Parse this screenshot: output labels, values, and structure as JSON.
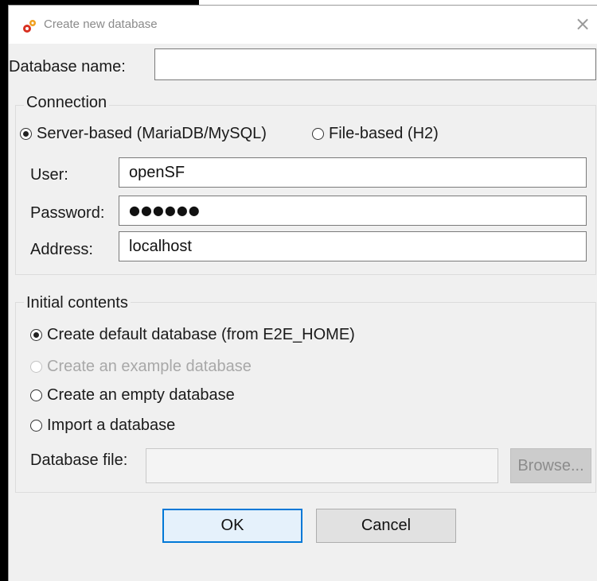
{
  "window": {
    "title": "Create new database",
    "app_icon": "gear-cluster-icon",
    "close_icon": "close-icon",
    "close_glyph": "×"
  },
  "database_name": {
    "label": "Database name:",
    "value": ""
  },
  "connection": {
    "title": "Connection",
    "modes": [
      {
        "label": "Server-based (MariaDB/MySQL)",
        "selected": true
      },
      {
        "label": "File-based (H2)",
        "selected": false
      }
    ],
    "user": {
      "label": "User:",
      "value": "openSF"
    },
    "password": {
      "label": "Password:",
      "masked_value": "●●●●●●"
    },
    "address": {
      "label": "Address:",
      "value": "localhost"
    }
  },
  "initial_contents": {
    "title": "Initial contents",
    "options": [
      {
        "label": "Create default database (from E2E_HOME)",
        "selected": true,
        "enabled": true
      },
      {
        "label": "Create an example database",
        "selected": false,
        "enabled": false
      },
      {
        "label": "Create an empty database",
        "selected": false,
        "enabled": true
      },
      {
        "label": "Import a database",
        "selected": false,
        "enabled": true
      }
    ],
    "database_file": {
      "label": "Database file:",
      "value": ""
    },
    "browse_label": "Browse..."
  },
  "buttons": {
    "ok": "OK",
    "cancel": "Cancel"
  },
  "colors": {
    "accent": "#0078d7",
    "dialog_bg": "#f0f0f0",
    "icon_orange": "#f0a020",
    "icon_red": "#d83020"
  }
}
